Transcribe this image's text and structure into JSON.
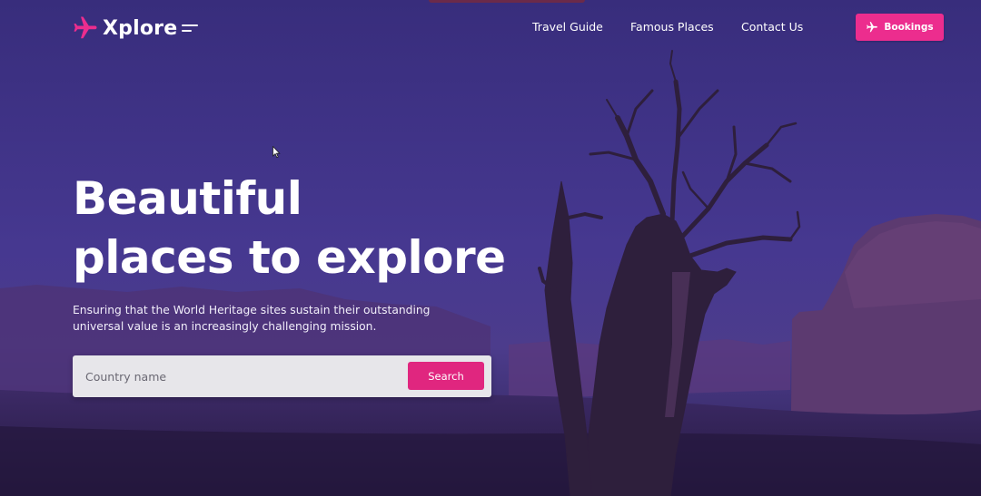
{
  "brand": {
    "name": "Xplore",
    "icon": "airplane-icon",
    "accent_color": "#ec2d8e"
  },
  "nav": {
    "links": [
      {
        "label": "Travel Guide"
      },
      {
        "label": "Famous Places"
      },
      {
        "label": "Contact Us"
      }
    ],
    "menu_icon": "menu-lines-icon",
    "bookings_label": "Bookings",
    "bookings_icon": "airplane-icon"
  },
  "hero": {
    "headline_line1": "Beautiful",
    "headline_line2": "places to explore",
    "description": "Ensuring that the World Heritage sites sustain their outstanding universal value is an increasingly challenging mission."
  },
  "search": {
    "placeholder": "Country name",
    "value": "",
    "button_label": "Search"
  },
  "colors": {
    "primary": "#ec2d8e",
    "background_overlay": "#43358a",
    "text": "#ffffff"
  }
}
